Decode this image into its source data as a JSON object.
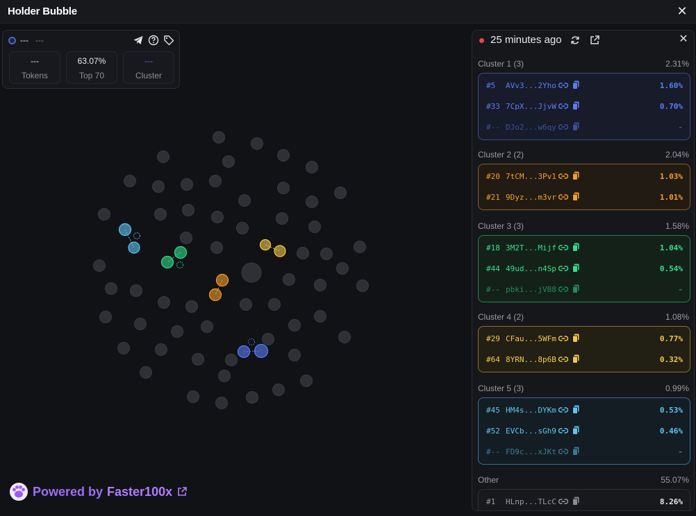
{
  "window": {
    "title": "Holder Bubble",
    "close_icon": "close-icon"
  },
  "info_card": {
    "name": "---",
    "subtitle": "---",
    "icons": [
      "telegram-icon",
      "help-icon",
      "tag-icon"
    ],
    "stats": [
      {
        "value": "---",
        "label": "Tokens",
        "color": "#e8e8ea"
      },
      {
        "value": "63.07%",
        "label": "Top 70",
        "color": "#e8e8ea"
      },
      {
        "value": "---",
        "label": "Cluster",
        "color": "#6b63d8"
      }
    ]
  },
  "powered": {
    "prefix": "Powered by",
    "brand": "Faster100x",
    "logo_icon": "paw-logo-icon",
    "external_icon": "external-link-icon"
  },
  "panel": {
    "time_label": "25 minutes ago",
    "icons": [
      "refresh-icon",
      "external-link-icon",
      "close-icon"
    ],
    "clusters": [
      {
        "title": "Cluster 1 (3)",
        "pct": "2.31%",
        "color": "#5b7cf7",
        "bg": "#171b2a",
        "border": "#3a4b8e",
        "rows": [
          {
            "rank": "#5",
            "addr": "AVv3...2Yho",
            "value": "1.60%",
            "dim": false
          },
          {
            "rank": "#33",
            "addr": "7CpX...JjvW",
            "value": "0.70%",
            "dim": false
          },
          {
            "rank": "#--",
            "addr": "DJo2...w6qy",
            "value": "-",
            "dim": true
          }
        ]
      },
      {
        "title": "Cluster 2 (2)",
        "pct": "2.04%",
        "color": "#f59e2a",
        "bg": "#221b14",
        "border": "#8c5b1f",
        "rows": [
          {
            "rank": "#20",
            "addr": "7tCM...3Pv1",
            "value": "1.03%",
            "dim": false
          },
          {
            "rank": "#21",
            "addr": "9Dyz...m3vr",
            "value": "1.01%",
            "dim": false
          }
        ]
      },
      {
        "title": "Cluster 3 (3)",
        "pct": "1.58%",
        "color": "#2fe08a",
        "bg": "#142119",
        "border": "#21864f",
        "rows": [
          {
            "rank": "#18",
            "addr": "3M2T...Mijf",
            "value": "1.04%",
            "dim": false
          },
          {
            "rank": "#44",
            "addr": "49ud...n4Sp",
            "value": "0.54%",
            "dim": false
          },
          {
            "rank": "#--",
            "addr": "pbki...jVB8",
            "value": "-",
            "dim": true
          }
        ]
      },
      {
        "title": "Cluster 4 (2)",
        "pct": "1.08%",
        "color": "#f5c84a",
        "bg": "#221f14",
        "border": "#8a7326",
        "rows": [
          {
            "rank": "#29",
            "addr": "CFau...5WFm",
            "value": "0.77%",
            "dim": false
          },
          {
            "rank": "#64",
            "addr": "8YRN...8p6B",
            "value": "0.32%",
            "dim": false
          }
        ]
      },
      {
        "title": "Cluster 5 (3)",
        "pct": "0.99%",
        "color": "#5fc4f2",
        "bg": "#141d23",
        "border": "#2f7296",
        "rows": [
          {
            "rank": "#45",
            "addr": "HM4s...DYKm",
            "value": "0.53%",
            "dim": false
          },
          {
            "rank": "#52",
            "addr": "EVCb...sGh9",
            "value": "0.46%",
            "dim": false
          },
          {
            "rank": "#--",
            "addr": "FD9c...xJKt",
            "value": "-",
            "dim": true
          }
        ]
      }
    ],
    "other": {
      "title": "Other",
      "pct": "55.07%",
      "color": "#9a9ca3",
      "bg": "#18191d",
      "border": "#2e3035",
      "rows": [
        {
          "rank": "#1",
          "addr": "HLnp...TLcC",
          "value": "8.26%",
          "dim": false
        }
      ]
    }
  }
}
